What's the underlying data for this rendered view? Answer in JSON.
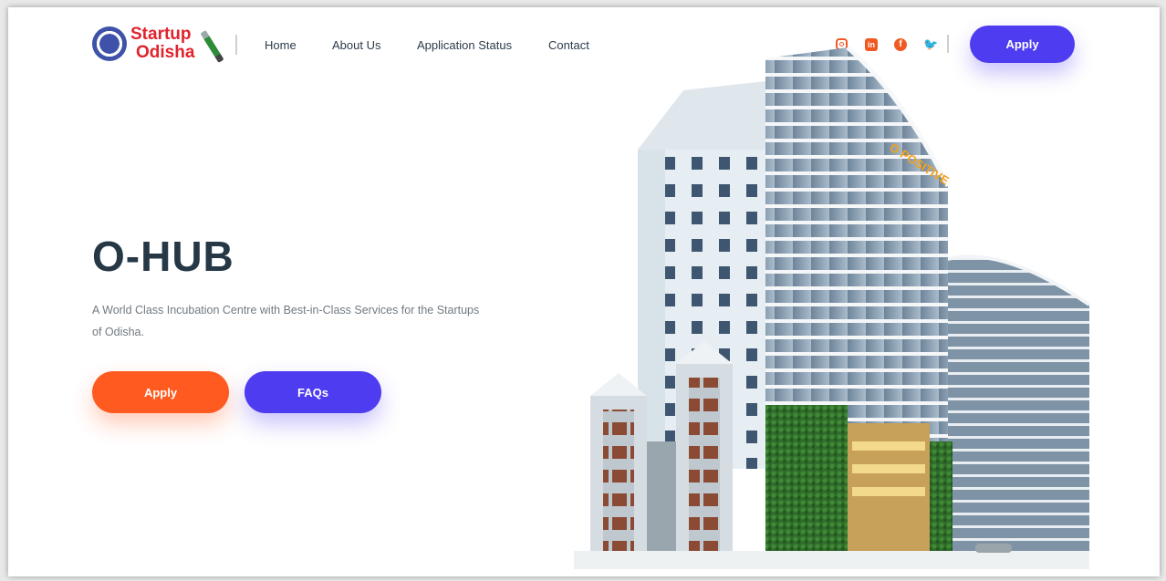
{
  "header": {
    "logo": {
      "line1": "Startup",
      "line2": "Odisha"
    },
    "nav": [
      {
        "label": "Home"
      },
      {
        "label": "About Us"
      },
      {
        "label": "Application Status"
      },
      {
        "label": "Contact"
      }
    ],
    "social": [
      {
        "icon": "instagram-icon"
      },
      {
        "icon": "linkedin-icon"
      },
      {
        "icon": "facebook-icon"
      },
      {
        "icon": "twitter-icon"
      }
    ],
    "apply_label": "Apply"
  },
  "hero": {
    "title": "O-HUB",
    "description": "A World Class Incubation Centre with Best-in-Class Services for the Startups of Odisha.",
    "apply_label": "Apply",
    "faq_label": "FAQs"
  },
  "colors": {
    "accent": "#4e3cf0",
    "orange": "#ff5a1f",
    "social": "#f05a22"
  }
}
